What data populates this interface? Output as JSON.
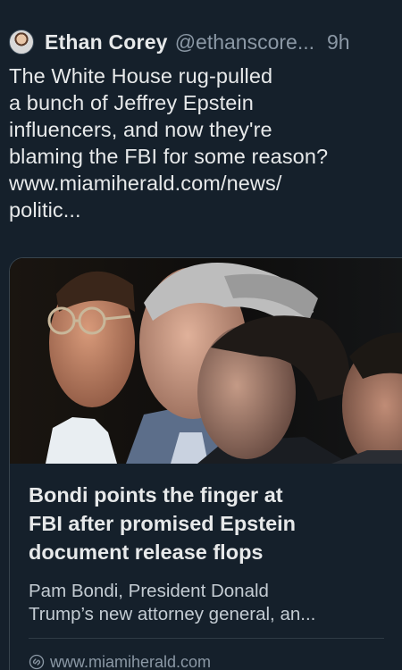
{
  "author": {
    "display_name": "Ethan Corey",
    "handle": "@ethanscore...",
    "timestamp": "9h"
  },
  "tweet": {
    "lines": [
      "The White House rug-pulled",
      "a bunch of Jeffrey Epstein",
      "influencers, and now they're",
      "blaming the FBI for some reason?",
      "www.miamiherald.com/news/",
      "politic..."
    ]
  },
  "card": {
    "image_alt": "photo of four men in profile",
    "title_lines": [
      "Bondi points the finger at",
      "FBI after promised Epstein",
      "document release flops"
    ],
    "description_lines": [
      "Pam Bondi, President Donald",
      "Trump’s new attorney general, an..."
    ],
    "domain": "www.miamiherald.com",
    "link_icon": "link-icon"
  },
  "colors": {
    "background": "#15202b",
    "text": "#e7e9ea",
    "muted": "#8b98a5",
    "border": "#38444d"
  }
}
